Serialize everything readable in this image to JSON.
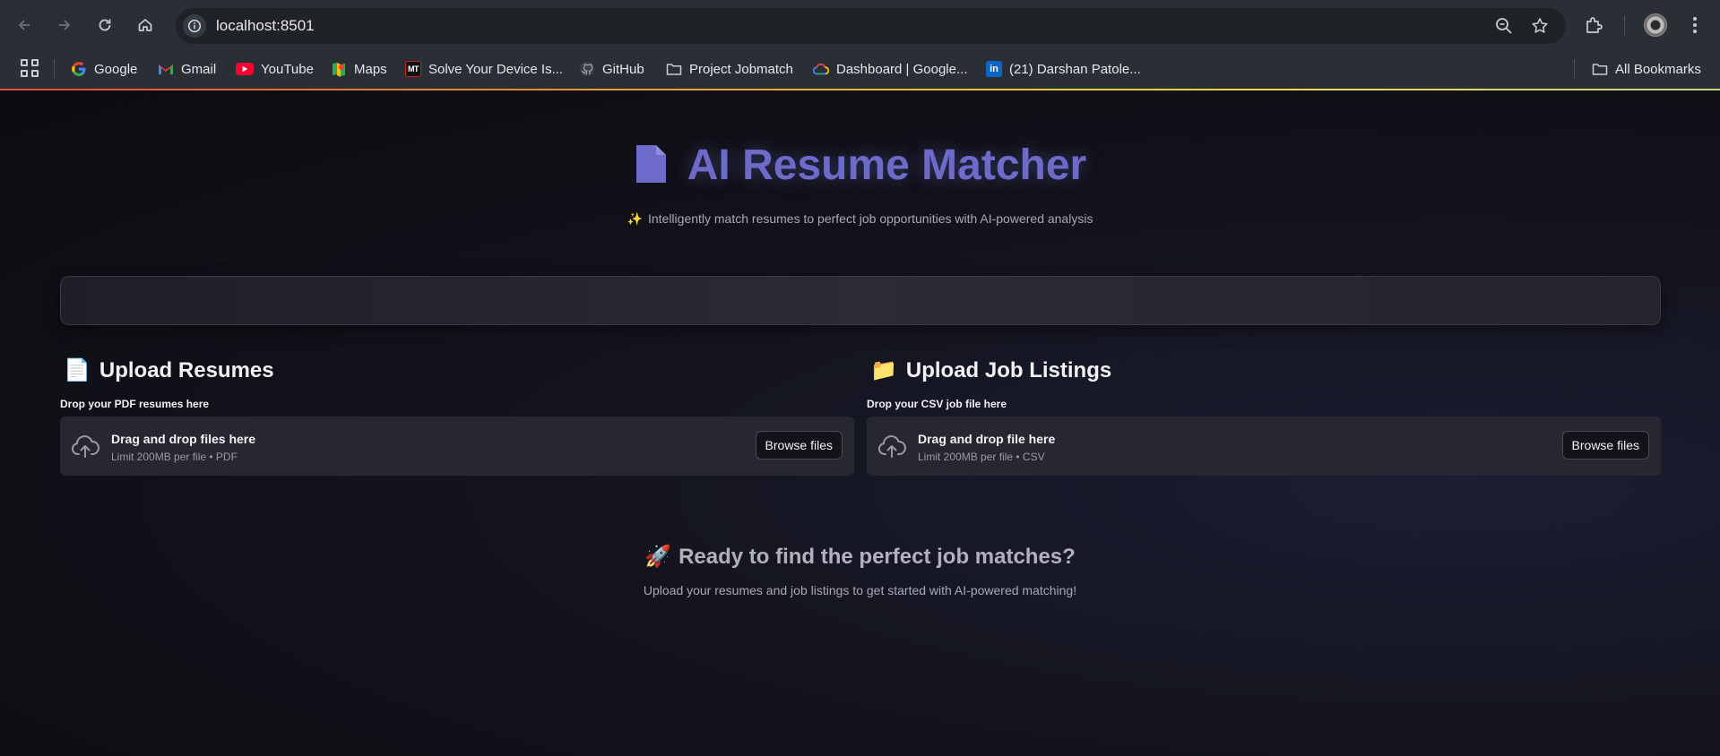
{
  "browser": {
    "url": "localhost:8501",
    "bookmarks": [
      {
        "label": "Google",
        "icon": "google-icon"
      },
      {
        "label": "Gmail",
        "icon": "gmail-icon"
      },
      {
        "label": "YouTube",
        "icon": "youtube-icon"
      },
      {
        "label": "Maps",
        "icon": "maps-icon"
      },
      {
        "label": "Solve Your Device Is...",
        "icon": "mt-icon",
        "icon_text": "MT"
      },
      {
        "label": "GitHub",
        "icon": "github-icon"
      },
      {
        "label": "Project Jobmatch",
        "icon": "folder-icon"
      },
      {
        "label": "Dashboard | Google...",
        "icon": "google-cloud-icon"
      },
      {
        "label": "(21) Darshan Patole...",
        "icon": "linkedin-icon",
        "icon_text": "in"
      }
    ],
    "all_bookmarks": "All Bookmarks"
  },
  "hero": {
    "title": "AI Resume Matcher",
    "subtitle": "Intelligently match resumes to perfect job opportunities with AI-powered analysis",
    "spark_glyph": "✨",
    "title_color": "#6d6ac9"
  },
  "resumes": {
    "section_title": "Upload Resumes",
    "section_glyph": "📄",
    "label": "Drop your PDF resumes here",
    "drop_title": "Drag and drop files here",
    "limit": "Limit 200MB per file • PDF",
    "browse_label": "Browse files"
  },
  "jobs": {
    "section_title": "Upload Job Listings",
    "section_glyph": "📁",
    "label": "Drop your CSV job file here",
    "drop_title": "Drag and drop file here",
    "limit": "Limit 200MB per file • CSV",
    "browse_label": "Browse files"
  },
  "cta": {
    "glyph": "🚀",
    "title": "Ready to find the perfect job matches?",
    "subtitle": "Upload your resumes and job listings to get started with AI-powered matching!"
  }
}
